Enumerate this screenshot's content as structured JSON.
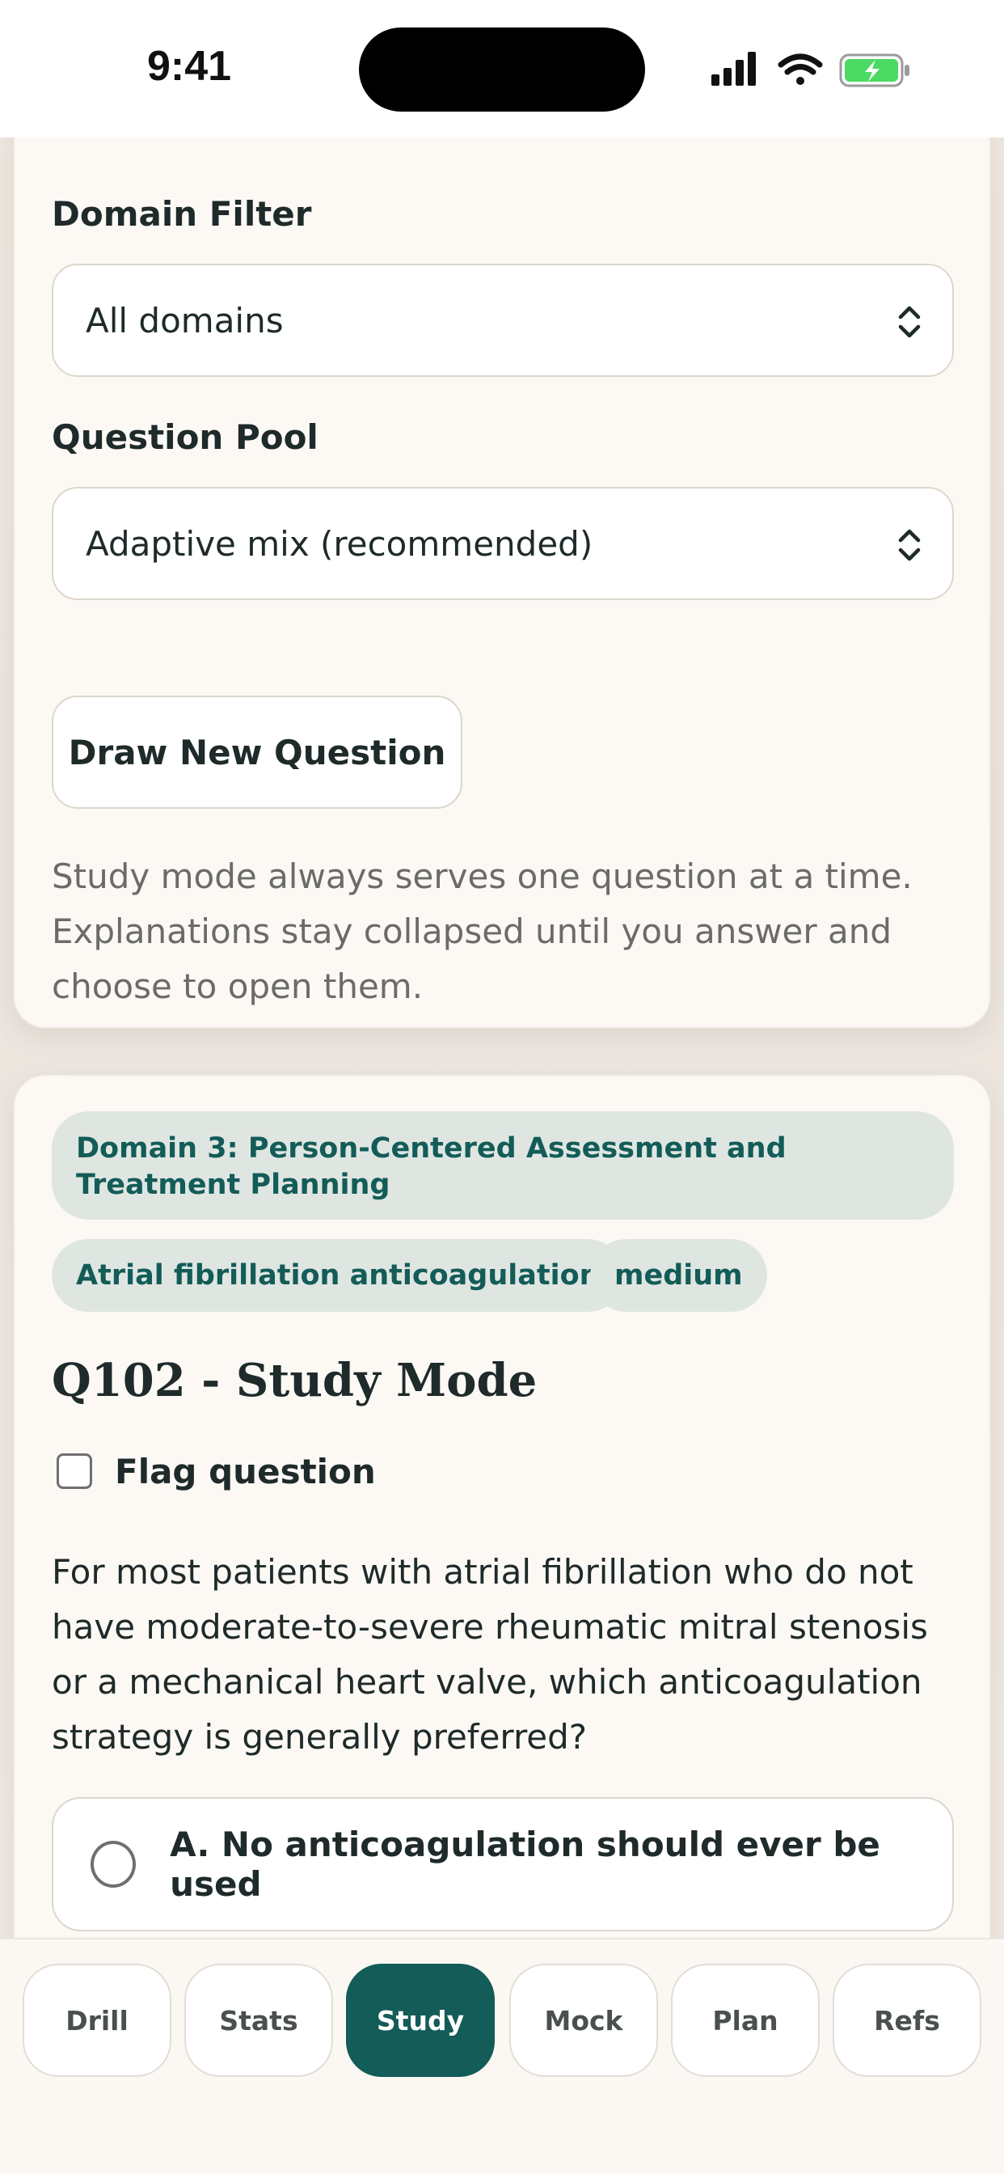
{
  "status": {
    "time": "9:41"
  },
  "filters": {
    "domain_label": "Domain Filter",
    "domain_value": "All domains",
    "pool_label": "Question Pool",
    "pool_value": "Adaptive mix (recommended)",
    "draw_button": "Draw New Question",
    "hint": "Study mode always serves one question at a time. Explanations stay collapsed until you answer and choose to open them."
  },
  "question": {
    "domain_chip": "Domain 3: Person-Centered Assessment and Treatment Planning",
    "topic_chip": "Atrial fibrillation anticoagulation",
    "difficulty_chip": "medium",
    "title": "Q102 - Study Mode",
    "flag_label": "Flag question",
    "flag_checked": false,
    "stem": "For most patients with atrial fibrillation who do not have moderate-to-severe rheumatic mitral stenosis or a mechanical heart valve, which anticoagulation strategy is generally preferred?",
    "options": [
      {
        "label": "A. No anticoagulation should ever be used"
      }
    ]
  },
  "nav": {
    "active": "Study",
    "tabs": [
      "Drill",
      "Stats",
      "Study",
      "Mock",
      "Plan",
      "Refs"
    ]
  },
  "colors": {
    "accent": "#135c58",
    "chip_bg": "#dfe6e2",
    "card_bg": "#fcf9f5",
    "battery": "#4cd964"
  },
  "icons": [
    "signal-icon",
    "wifi-icon",
    "battery-charging-icon",
    "chevron-updown-icon"
  ]
}
